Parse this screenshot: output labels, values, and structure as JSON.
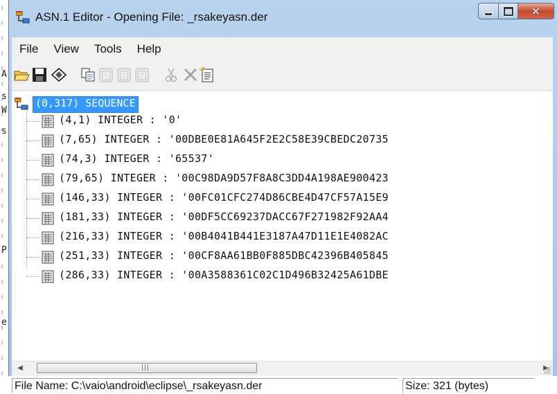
{
  "window": {
    "title": "ASN.1 Editor - Opening File: _rsakeyasn.der"
  },
  "menubar": {
    "items": [
      "File",
      "View",
      "Tools",
      "Help"
    ]
  },
  "toolbar": {
    "buttons": [
      "open-icon",
      "save-icon",
      "compare-icon",
      "copy-icon",
      "paste-icon",
      "paste-icon",
      "paste-icon",
      "cut-icon",
      "delete-icon",
      "new-node-icon"
    ]
  },
  "tree": {
    "root": "(0,317) SEQUENCE",
    "children": [
      "(4,1) INTEGER : '0'",
      "(7,65) INTEGER : '00DBE0E81A645F2E2C58E39CBEDC20735",
      "(74,3) INTEGER : '65537'",
      "(79,65) INTEGER : '00C98DA9D57F8A8C3DD4A198AE900423",
      "(146,33) INTEGER : '00FC01CFC274D86CBE4D47CF57A15E9",
      "(181,33) INTEGER : '00DF5CC69237DACC67F271982F92AA4",
      "(216,33) INTEGER : '00B4041B441E3187A47D11E1E4082AC",
      "(251,33) INTEGER : '00CF8AA61BB0F885DBC42396B405845",
      "(286,33) INTEGER : '00A3588361C02C1D496B32425A61DBE"
    ]
  },
  "statusbar": {
    "file_name": "File Name: C:\\vaio\\android\\eclipse\\_rsakeyasn.der",
    "size": "Size: 321 (bytes)"
  },
  "background": {
    "chars": [
      "A",
      "s",
      "W",
      "s",
      "P",
      "e"
    ]
  }
}
